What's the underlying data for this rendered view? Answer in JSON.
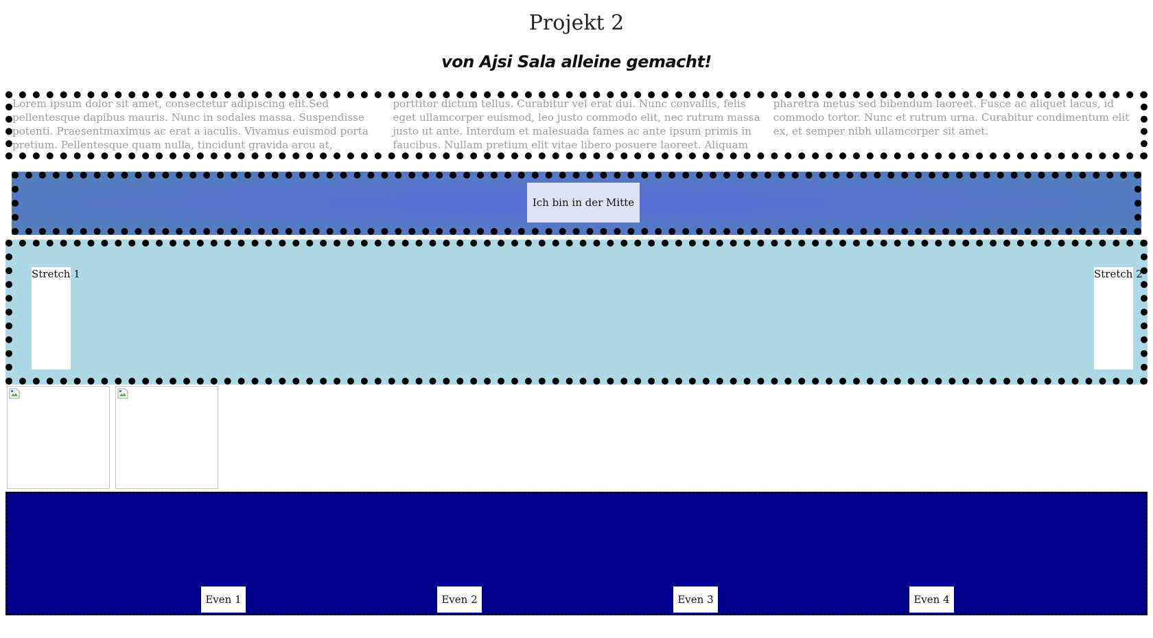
{
  "header": {
    "title": "Projekt 2",
    "subtitle": "von Ajsi Sala alleine gemacht!"
  },
  "columns_section": {
    "text": "Lorem ipsum dolor sit amet, consectetur adipiscing elit.Sed pellentesque dapibus mauris. Nunc in sodales massa. Suspendisse potenti. Praesentmaximus ac erat a iaculis. Vivamus euismod porta pretium. Pellentesque quam nulla, tincidunt gravida arcu at, porttitor dictum tellus. Curabitur vel erat dui. Nunc convallis, felis eget ullamcorper euismod, leo justo commodo elit, nec rutrum massa justo ut ante. Interdum et malesuada fames ac ante ipsum primis in faucibus. Nullam pretium elit vitae libero posuere laoreet. Aliquam pharetra metus sed bibendum laoreet. Fusce ac aliquet lacus, id commodo tortor. Nunc et rutrum urna. Curabitur condimentum elit ex, et semper nibh ullamcorper sit amet."
  },
  "center_section": {
    "item_label": "Ich bin in der Mitte"
  },
  "stretch_section": {
    "items": [
      {
        "label": "Stretch 1"
      },
      {
        "label": "Stretch 2"
      }
    ]
  },
  "even_section": {
    "items": [
      {
        "label": "Even 1"
      },
      {
        "label": "Even 2"
      },
      {
        "label": "Even 3"
      },
      {
        "label": "Even 4"
      }
    ]
  },
  "colors": {
    "center_background": "#5a6bdc",
    "stretch_background": "#add8e6",
    "even_background": "#00008b",
    "column_text": "#9e9e9e"
  },
  "icons": {
    "broken_image": "broken-image-icon"
  }
}
